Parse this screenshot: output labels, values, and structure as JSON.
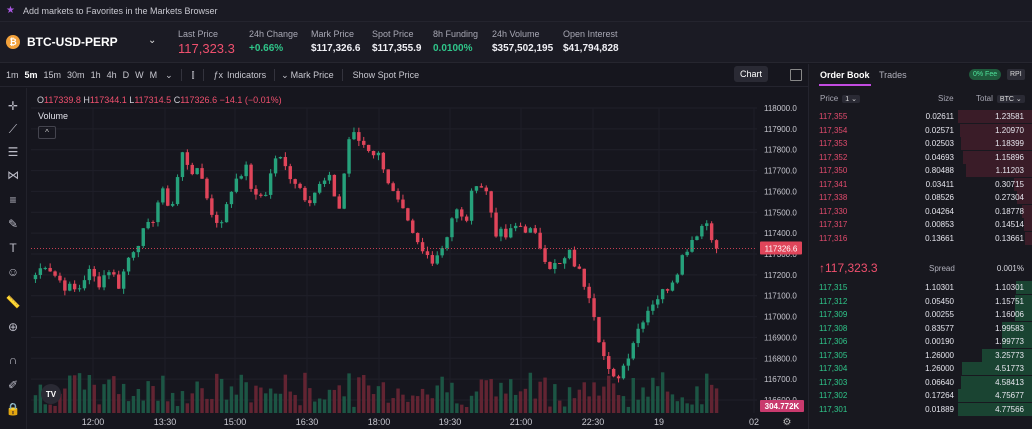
{
  "banner": {
    "text": "Add markets to Favorites in the Markets Browser"
  },
  "market": {
    "coin_glyph": "₿",
    "symbol": "BTC-USD-PERP"
  },
  "stats": [
    {
      "label": "Last Price",
      "value": "117,323.3",
      "tone": "red"
    },
    {
      "label": "24h Change",
      "value": "+0.66%",
      "tone": "green"
    },
    {
      "label": "Mark Price",
      "value": "$117,326.6",
      "tone": "plain"
    },
    {
      "label": "Spot Price",
      "value": "$117,355.9",
      "tone": "plain"
    },
    {
      "label": "8h Funding",
      "value": "0.0100%",
      "tone": "green"
    },
    {
      "label": "24h Volume",
      "value": "$357,502,195",
      "tone": "plain"
    },
    {
      "label": "Open Interest",
      "value": "$41,794,828",
      "tone": "plain"
    }
  ],
  "toolbar": {
    "timeframes": [
      "1m",
      "5m",
      "15m",
      "30m",
      "1h",
      "4h",
      "D",
      "W",
      "M"
    ],
    "active_timeframe": "5m",
    "indicators_label": "Indicators",
    "mark_price_label": "Mark Price",
    "show_spot_label": "Show Spot Price",
    "chart_label": "Chart"
  },
  "legend": {
    "o_label": "O",
    "o": "117339.8",
    "h_label": "H",
    "h": "117344.1",
    "l_label": "L",
    "l": "117314.5",
    "c_label": "C",
    "c": "117326.6",
    "change": "−14.1 (−0.01%)",
    "volume_label": "Volume",
    "collapse_glyph": "^"
  },
  "chart_data": {
    "type": "candlestick",
    "y_ticks": [
      "118000.0",
      "117900.0",
      "117800.0",
      "117700.0",
      "117600.0",
      "117500.0",
      "117400.0",
      "117300.0",
      "117200.0",
      "117100.0",
      "117000.0",
      "116900.0",
      "116800.0",
      "116700.0",
      "116600.0"
    ],
    "ylim": [
      116600,
      118000
    ],
    "x_ticks": [
      "12:00",
      "13:30",
      "15:00",
      "16:30",
      "18:00",
      "19:30",
      "21:00",
      "22:30",
      "19",
      "02"
    ],
    "current_price_label": "117326.6",
    "current_price": 117326.6,
    "volume_label_value": "304.772K",
    "up_color": "#26a17b",
    "down_color": "#e0455a",
    "anchor_closes": [
      117200,
      117260,
      117190,
      117140,
      117120,
      117220,
      117160,
      117230,
      117150,
      117300,
      117380,
      117440,
      117600,
      117520,
      117780,
      117700,
      117660,
      117450,
      117480,
      117660,
      117720,
      117560,
      117600,
      117780,
      117700,
      117640,
      117560,
      117620,
      117660,
      117520,
      117880,
      117840,
      117800,
      117760,
      117600,
      117500,
      117380,
      117300,
      117280,
      117350,
      117520,
      117440,
      117660,
      117600,
      117400,
      117380,
      117440,
      117420,
      117360,
      117250,
      117240,
      117300,
      117200,
      117100,
      116850,
      116680,
      116750,
      116880,
      117000,
      117080,
      117120,
      117200,
      117320,
      117400,
      117460,
      117340
    ]
  },
  "orderbook": {
    "tab_orderbook": "Order Book",
    "tab_trades": "Trades",
    "fee_badge": "0% Fee",
    "rpi_badge": "RPI",
    "col_price": "Price",
    "price_step": "1",
    "col_size": "Size",
    "col_total": "Total",
    "total_unit": "BTC",
    "asks": [
      {
        "price": "117,355",
        "size": "0.02611",
        "total": "1.23581",
        "depth": 1.0
      },
      {
        "price": "117,354",
        "size": "0.02571",
        "total": "1.20970",
        "depth": 0.98
      },
      {
        "price": "117,353",
        "size": "0.02503",
        "total": "1.18399",
        "depth": 0.96
      },
      {
        "price": "117,352",
        "size": "0.04693",
        "total": "1.15896",
        "depth": 0.94
      },
      {
        "price": "117,350",
        "size": "0.80488",
        "total": "1.11203",
        "depth": 0.9
      },
      {
        "price": "117,341",
        "size": "0.03411",
        "total": "0.30715",
        "depth": 0.25
      },
      {
        "price": "117,338",
        "size": "0.08526",
        "total": "0.27304",
        "depth": 0.22
      },
      {
        "price": "117,330",
        "size": "0.04264",
        "total": "0.18778",
        "depth": 0.15
      },
      {
        "price": "117,317",
        "size": "0.00853",
        "total": "0.14514",
        "depth": 0.12
      },
      {
        "price": "117,316",
        "size": "0.13661",
        "total": "0.13661",
        "depth": 0.11
      }
    ],
    "mid_price": "↑117,323.3",
    "spread_label": "Spread",
    "spread_value": "0.001%",
    "bids": [
      {
        "price": "117,315",
        "size": "1.10301",
        "total": "1.10301",
        "depth": 0.23
      },
      {
        "price": "117,312",
        "size": "0.05450",
        "total": "1.15751",
        "depth": 0.24
      },
      {
        "price": "117,309",
        "size": "0.00255",
        "total": "1.16006",
        "depth": 0.24
      },
      {
        "price": "117,308",
        "size": "0.83577",
        "total": "1.99583",
        "depth": 0.42
      },
      {
        "price": "117,306",
        "size": "0.00190",
        "total": "1.99773",
        "depth": 0.42
      },
      {
        "price": "117,305",
        "size": "1.26000",
        "total": "3.25773",
        "depth": 0.68
      },
      {
        "price": "117,304",
        "size": "1.26000",
        "total": "4.51773",
        "depth": 0.95
      },
      {
        "price": "117,303",
        "size": "0.06640",
        "total": "4.58413",
        "depth": 0.96
      },
      {
        "price": "117,302",
        "size": "0.17264",
        "total": "4.75677",
        "depth": 1.0
      },
      {
        "price": "117,301",
        "size": "0.01889",
        "total": "4.77566",
        "depth": 1.0
      }
    ]
  }
}
